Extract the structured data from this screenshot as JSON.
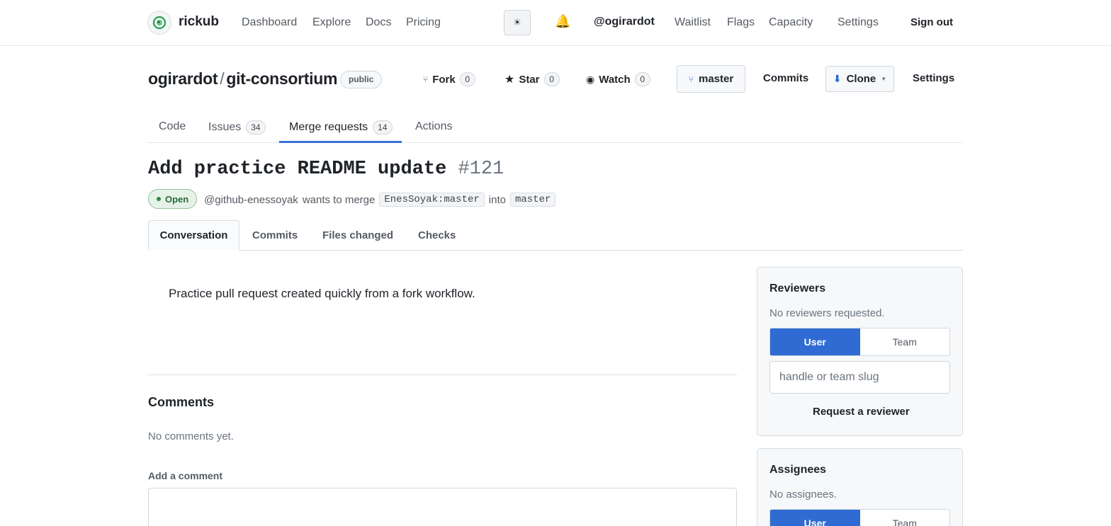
{
  "nav": {
    "brand": "rickub",
    "links": [
      "Dashboard",
      "Explore",
      "Docs",
      "Pricing"
    ],
    "theme_icon": "☀",
    "bell_icon": "🔔",
    "handle": "@ogirardot",
    "right_links": [
      "Waitlist",
      "Flags",
      "Capacity",
      "Settings"
    ],
    "sign_out": "Sign out"
  },
  "repo": {
    "owner": "ogirardot",
    "separator": "/",
    "name": "git-consortium",
    "visibility": "public",
    "fork_label": "Fork",
    "fork_count": "0",
    "star_label": "Star",
    "star_count": "0",
    "watch_label": "Watch",
    "watch_count": "0",
    "branch": "master",
    "commits_label": "Commits",
    "clone_label": "Clone",
    "settings_label": "Settings"
  },
  "repo_tabs": {
    "code": "Code",
    "issues": "Issues",
    "issues_count": "34",
    "merge_requests": "Merge requests",
    "merge_requests_count": "14",
    "actions": "Actions"
  },
  "mr": {
    "title": "Add practice README update",
    "number": "#121",
    "status": "Open",
    "author": "@github-enessoyak",
    "wants_to_merge": "wants to merge",
    "source": "EnesSoyak:master",
    "into": "into",
    "target": "master",
    "description": "Practice pull request created quickly from a fork workflow."
  },
  "mr_tabs": {
    "conversation": "Conversation",
    "commits": "Commits",
    "files_changed": "Files changed",
    "checks": "Checks"
  },
  "comments": {
    "heading": "Comments",
    "empty": "No comments yet.",
    "add_label": "Add a comment"
  },
  "reviewers": {
    "heading": "Reviewers",
    "empty": "No reviewers requested.",
    "user_tab": "User",
    "team_tab": "Team",
    "input_placeholder": "handle or team slug",
    "request_button": "Request a reviewer"
  },
  "assignees": {
    "heading": "Assignees",
    "empty": "No assignees.",
    "user_tab": "User",
    "team_tab": "Team"
  },
  "colors": {
    "accent": "#2f6bd3",
    "open_green": "#2b6a3a"
  }
}
